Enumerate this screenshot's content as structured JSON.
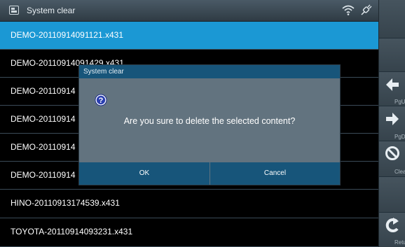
{
  "window": {
    "title": "System clear"
  },
  "list": {
    "items": [
      "DEMO-20110914091121.x431",
      "DEMO-20110914091429.x431",
      "DEMO-20110914",
      "DEMO-20110914",
      "DEMO-20110914",
      "DEMO-20110914",
      "HINO-20110913174539.x431",
      "TOYOTA-20110914093231.x431"
    ],
    "selected_index": 0
  },
  "sidebar": {
    "pgup_label": "PgU",
    "pgdn_label": "PgD",
    "clear_label": "Clea",
    "return_label": "Retur"
  },
  "dialog": {
    "title": "System clear",
    "message": "Are you sure to delete the selected content?",
    "ok_label": "OK",
    "cancel_label": "Cancel",
    "icon": "question-icon"
  },
  "colors": {
    "selected_row": "#1b98d4",
    "dialog_header": "#17557a",
    "dialog_body": "#62737f"
  },
  "status_icons": [
    "wifi-icon",
    "plug-icon"
  ]
}
